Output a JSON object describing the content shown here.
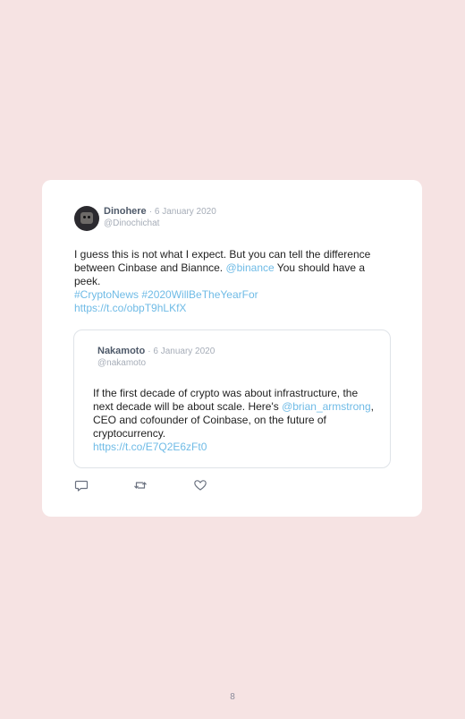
{
  "tweet": {
    "author_name": "Dinohere",
    "date": "· 6 January 2020",
    "handle": "@Dinochichat",
    "text_part1": "I guess this is not what I expect. But you can tell the difference between Cinbase and Biannce. ",
    "mention": "@binance",
    "text_part2": " You should have a peek.",
    "hashtags": "#CryptoNews #2020WillBeTheYearFor",
    "link": "https://t.co/obpT9hLKfX"
  },
  "quoted_tweet": {
    "author_name": "Nakamoto",
    "date": "· 6 January 2020",
    "handle": "@nakamoto",
    "text_part1": "If the first decade of crypto was about infrastructure, the next decade will be about scale. Here's ",
    "mention": "@brian_armstrong",
    "text_part2": ", CEO and cofounder of Coinbase, on the future of cryptocurrency.",
    "link": "https://t.co/E7Q2E6zFt0"
  },
  "actions": {
    "reply_icon": "reply-icon",
    "retweet_icon": "retweet-icon",
    "like_icon": "heart-icon"
  },
  "colors": {
    "background": "#f6e3e3",
    "link": "#6fbbe6",
    "card": "#ffffff"
  },
  "page": {
    "number": "8"
  }
}
